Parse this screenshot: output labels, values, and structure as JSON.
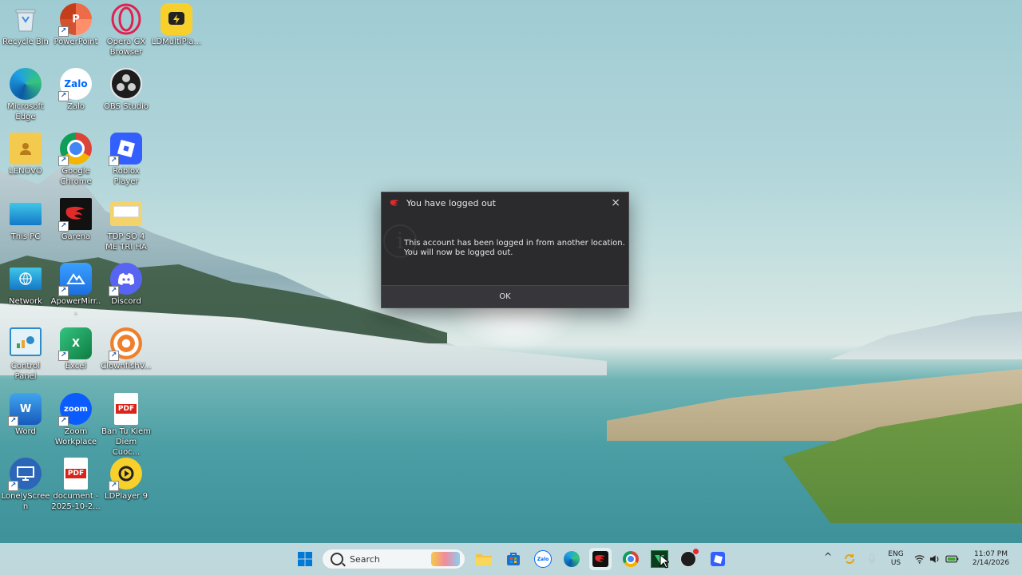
{
  "desktop": {
    "icons": [
      {
        "label": "Recycle Bin"
      },
      {
        "label": "PowerPoint"
      },
      {
        "label": "Opera GX Browser"
      },
      {
        "label": "LDMultiPla..."
      },
      {
        "label": "Microsoft Edge"
      },
      {
        "label": "Zalo"
      },
      {
        "label": "OBS Studio"
      },
      {
        "label": "LENOVO"
      },
      {
        "label": "Google Chrome"
      },
      {
        "label": "Roblox Player"
      },
      {
        "label": "This PC"
      },
      {
        "label": "Garena"
      },
      {
        "label": "TDP SO 4 ME TRI HA"
      },
      {
        "label": "Network"
      },
      {
        "label": "ApowerMirr..."
      },
      {
        "label": "Discord"
      },
      {
        "label": "Control Panel"
      },
      {
        "label": "Excel"
      },
      {
        "label": "ClownfishV..."
      },
      {
        "label": "Word"
      },
      {
        "label": "Zoom Workplace"
      },
      {
        "label": "Ban Tu Kiem Diem Cuoc..."
      },
      {
        "label": "LonelyScreen"
      },
      {
        "label": "document - 2025-10-2..."
      },
      {
        "label": "LDPlayer 9"
      }
    ],
    "icon_glyphs": {
      "zalo": "Zalo",
      "zoom": "zoom",
      "pdf": "PDF"
    }
  },
  "dialog": {
    "title": "You have logged out",
    "close_glyph": "×",
    "message_line1": "This account has been logged in from another location.",
    "message_line2": "You will now be logged out.",
    "info_glyph": "i",
    "ok_label": "OK"
  },
  "taskbar": {
    "search_placeholder": "Search",
    "tray": {
      "language_line1": "ENG",
      "language_line2": "US",
      "time": "11:07 PM",
      "date": "2/14/2026",
      "chevron_glyph": "^"
    }
  }
}
